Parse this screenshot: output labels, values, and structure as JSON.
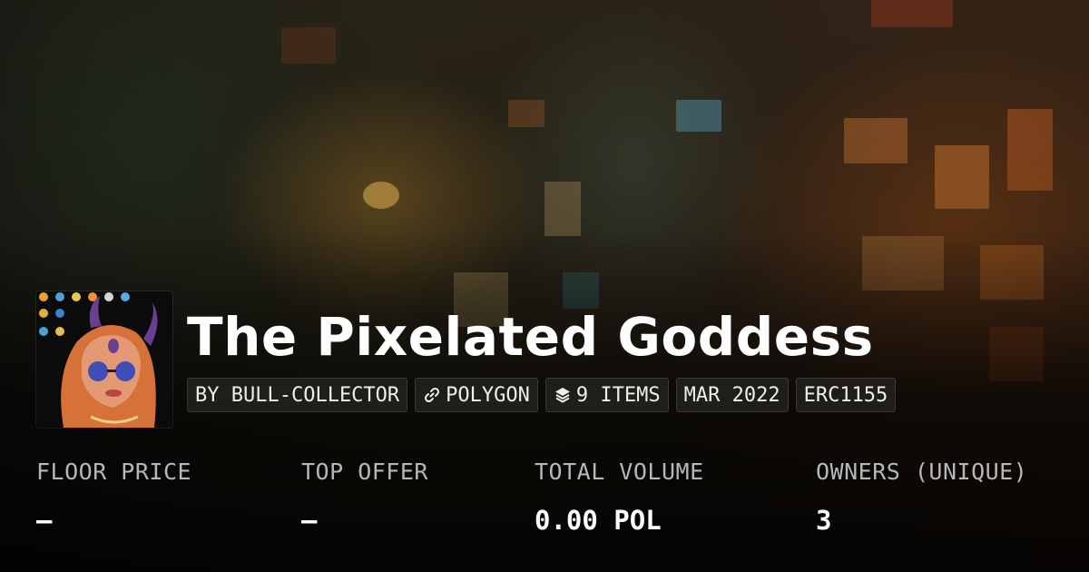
{
  "collection": {
    "title": "The Pixelated Goddess"
  },
  "tags": {
    "creator": "BY BULL-COLLECTOR",
    "chain": "POLYGON",
    "chain_icon": "link-icon",
    "items": "9 ITEMS",
    "items_icon": "layers-icon",
    "date": "MAR 2022",
    "standard": "ERC1155"
  },
  "stats": [
    {
      "label": "FLOOR PRICE",
      "value": "—"
    },
    {
      "label": "TOP OFFER",
      "value": "—"
    },
    {
      "label": "TOTAL VOLUME",
      "value": "0.00 POL"
    },
    {
      "label": "OWNERS (UNIQUE)",
      "value": "3"
    }
  ],
  "colors": {
    "text": "#ffffff",
    "muted_label": "#b7b7b7",
    "tag_background": "#282622"
  }
}
